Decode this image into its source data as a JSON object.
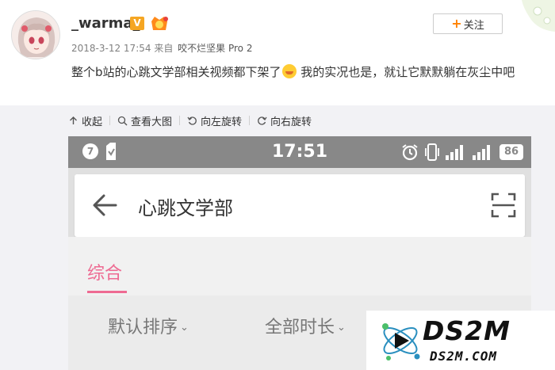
{
  "post": {
    "username": "_warma_",
    "verified_badge": "V",
    "timestamp": "2018-3-12 17:54",
    "source_prefix": "来自",
    "source_device": "咬不烂坚果 Pro 2",
    "follow_label": "关注",
    "text_part1": "整个b站的心跳文学部相关视频都下架了",
    "text_part2": " 我的实况也是，就让它默默躺在灰尘中吧"
  },
  "media_toolbar": {
    "collapse": "收起",
    "view_large": "查看大图",
    "rotate_left": "向左旋转",
    "rotate_right": "向右旋转"
  },
  "phone": {
    "status_notification_count": "7",
    "status_time": "17:51",
    "battery": "86",
    "search_title": "心跳文学部",
    "tab_active": "综合",
    "filter_sort": "默认排序",
    "filter_duration": "全部时长"
  },
  "watermark": {
    "main": "DS2M",
    "sub": "DS2M.COM"
  },
  "colors": {
    "accent_pink": "#ee6a92",
    "follow_orange": "#ff8200",
    "status_bar_gray": "#888888"
  }
}
